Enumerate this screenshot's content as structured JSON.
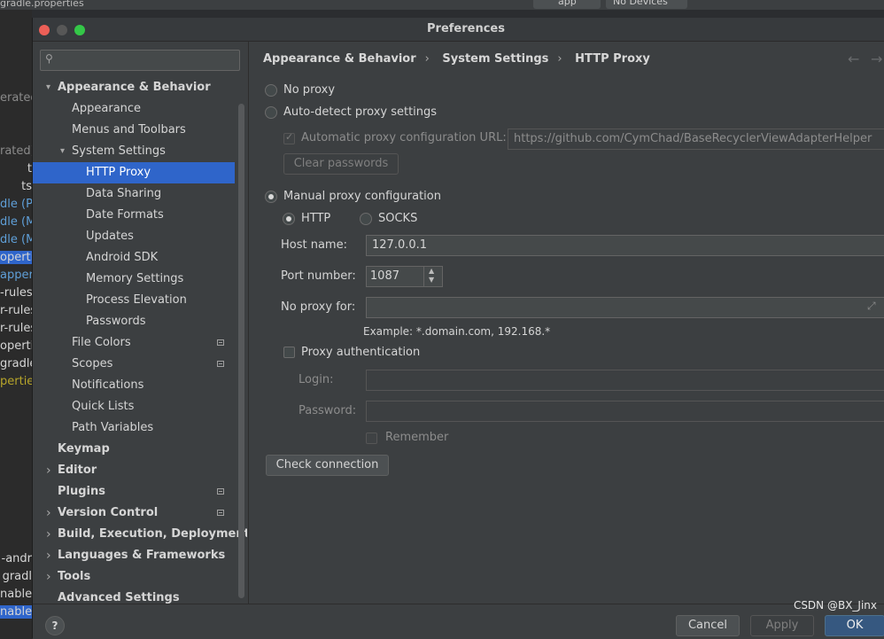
{
  "ide": {
    "tab_label": "gradle.properties",
    "run_config": "app",
    "device": "No Devices",
    "left_snippets": [
      "erated",
      "rated)",
      "t",
      "ts",
      "dle (Pr",
      "dle (M",
      "dle (M",
      "operti",
      "apper",
      "-rules",
      "r-rules",
      "r-rules",
      "opertie",
      "gradle",
      "perties",
      "-andr",
      "gradl",
      "nable",
      "nable"
    ]
  },
  "dialog": {
    "title": "Preferences",
    "search": {
      "placeholder": "",
      "value": ""
    },
    "sidebar": [
      {
        "label": "Appearance & Behavior",
        "level": 0,
        "bold": true,
        "arrow": "▾"
      },
      {
        "label": "Appearance",
        "level": 1
      },
      {
        "label": "Menus and Toolbars",
        "level": 1
      },
      {
        "label": "System Settings",
        "level": 1,
        "arrow": "▾"
      },
      {
        "label": "HTTP Proxy",
        "level": 2,
        "selected": true
      },
      {
        "label": "Data Sharing",
        "level": 2
      },
      {
        "label": "Date Formats",
        "level": 2
      },
      {
        "label": "Updates",
        "level": 2
      },
      {
        "label": "Android SDK",
        "level": 2
      },
      {
        "label": "Memory Settings",
        "level": 2
      },
      {
        "label": "Process Elevation",
        "level": 2
      },
      {
        "label": "Passwords",
        "level": 2
      },
      {
        "label": "File Colors",
        "level": 1,
        "icon": true
      },
      {
        "label": "Scopes",
        "level": 1,
        "icon": true
      },
      {
        "label": "Notifications",
        "level": 1
      },
      {
        "label": "Quick Lists",
        "level": 1
      },
      {
        "label": "Path Variables",
        "level": 1
      },
      {
        "label": "Keymap",
        "level": 0,
        "bold": true
      },
      {
        "label": "Editor",
        "level": 0,
        "bold": true,
        "arrow": "›"
      },
      {
        "label": "Plugins",
        "level": 0,
        "bold": true,
        "icon": true
      },
      {
        "label": "Version Control",
        "level": 0,
        "bold": true,
        "arrow": "›",
        "icon": true
      },
      {
        "label": "Build, Execution, Deployment",
        "level": 0,
        "bold": true,
        "arrow": "›"
      },
      {
        "label": "Languages & Frameworks",
        "level": 0,
        "bold": true,
        "arrow": "›"
      },
      {
        "label": "Tools",
        "level": 0,
        "bold": true,
        "arrow": "›"
      },
      {
        "label": "Advanced Settings",
        "level": 0,
        "bold": true
      }
    ],
    "breadcrumb": [
      "Appearance & Behavior",
      "System Settings",
      "HTTP Proxy"
    ],
    "proxy": {
      "no_proxy": "No proxy",
      "auto_detect": "Auto-detect proxy settings",
      "auto_url_label": "Automatic proxy configuration URL:",
      "auto_url_value": "https://github.com/CymChad/BaseRecyclerViewAdapterHelper",
      "clear_passwords": "Clear passwords",
      "manual": "Manual proxy configuration",
      "http": "HTTP",
      "socks": "SOCKS",
      "host_label": "Host name:",
      "host_value": "127.0.0.1",
      "port_label": "Port number:",
      "port_value": "1087",
      "no_proxy_for_label": "No proxy for:",
      "no_proxy_for_value": "",
      "example": "Example: *.domain.com, 192.168.*",
      "proxy_auth": "Proxy authentication",
      "login_label": "Login:",
      "login_value": "",
      "password_label": "Password:",
      "password_value": "",
      "remember": "Remember",
      "check_connection": "Check connection",
      "selected_mode": "manual",
      "selected_type": "HTTP"
    },
    "footer": {
      "help": "?",
      "cancel": "Cancel",
      "apply": "Apply",
      "ok": "OK"
    }
  },
  "watermark": "CSDN @BX_Jinx",
  "colors": {
    "selection": "#2f65ca",
    "dialog_bg": "#3c3f41",
    "text": "#d5d5d5",
    "close": "#ec5f57",
    "minimize": "#575757",
    "zoom": "#34c748"
  }
}
